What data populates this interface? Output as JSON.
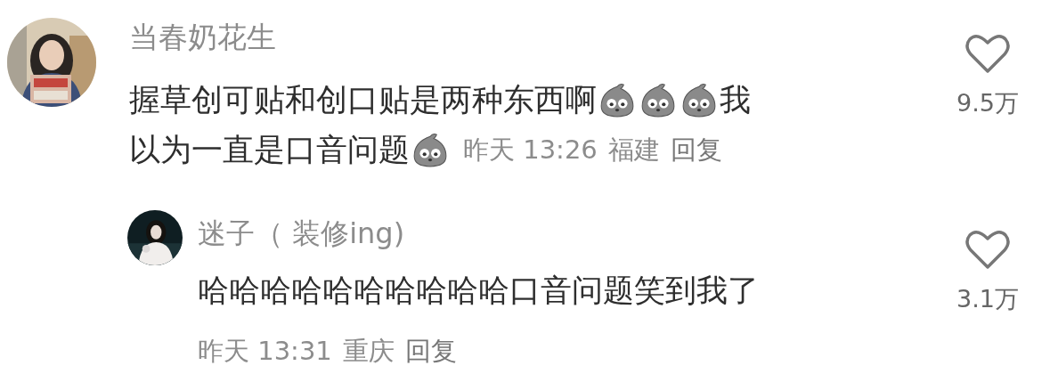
{
  "comments": [
    {
      "username": "当春奶花生",
      "lines": [
        [
          {
            "kind": "text",
            "text": "握草创可贴和创口贴是两种东西啊"
          },
          {
            "kind": "emoji"
          },
          {
            "kind": "emoji"
          },
          {
            "kind": "emoji"
          },
          {
            "kind": "text",
            "text": "我"
          }
        ],
        [
          {
            "kind": "text",
            "text": "以为一直是口音问题"
          },
          {
            "kind": "emoji"
          }
        ]
      ],
      "time": "昨天 13:26",
      "location": "福建",
      "reply_label": "回复",
      "likes": "9.5万",
      "replies": [
        {
          "username": "迷子（ 装修ing)",
          "lines": [
            [
              {
                "kind": "text",
                "text": "哈哈哈哈哈哈哈哈哈哈口音问题笑到我了"
              }
            ]
          ],
          "time": "昨天 13:31",
          "location": "重庆",
          "reply_label": "回复",
          "likes": "3.1万"
        }
      ]
    }
  ]
}
